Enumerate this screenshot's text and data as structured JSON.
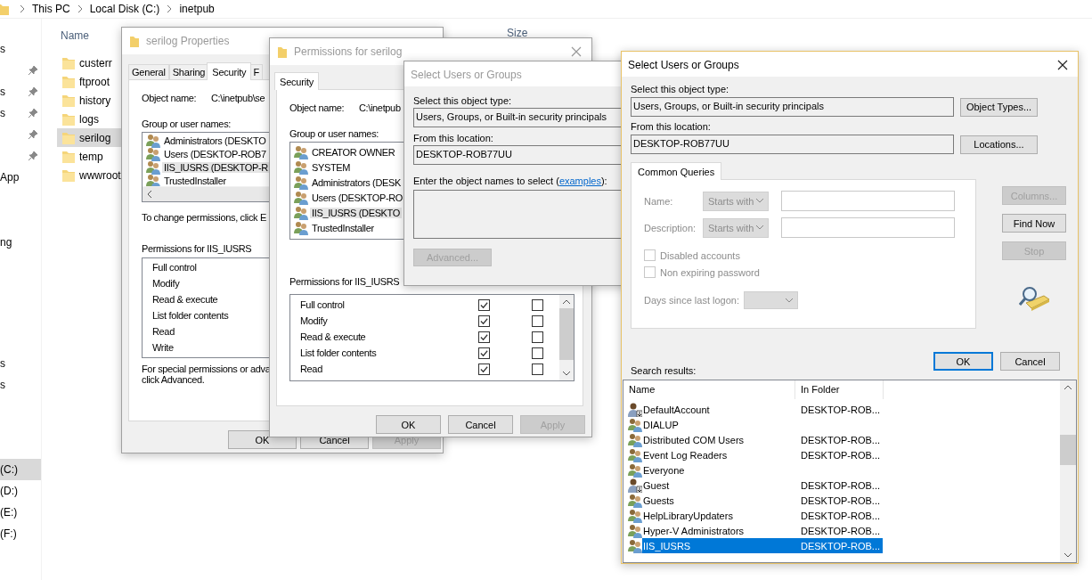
{
  "explorer": {
    "breadcrumb": [
      "This PC",
      "Local Disk (C:)",
      "inetpub"
    ],
    "nav_sections": [
      [
        {
          "label": "s",
          "pinned": false,
          "selected": false
        },
        {
          "pinned": true,
          "selected": false
        },
        {
          "label": "s",
          "pinned": true,
          "selected": false
        },
        {
          "label": "s",
          "pinned": true,
          "selected": false
        },
        {
          "pinned": true,
          "selected": false
        },
        {
          "pinned": true,
          "selected": false
        },
        {
          "label": "App",
          "pinned": false,
          "selected": false
        }
      ],
      [
        {
          "label": "ng",
          "pinned": false,
          "selected": false
        }
      ],
      [
        {
          "label": "s",
          "pinned": false,
          "selected": false
        },
        {
          "label": "s",
          "pinned": false,
          "selected": false
        }
      ],
      [
        {
          "label": "(C:)",
          "pinned": false,
          "selected": true
        },
        {
          "label": "(D:)",
          "pinned": false,
          "selected": false
        },
        {
          "label": "(E:)",
          "pinned": false,
          "selected": false
        },
        {
          "label": "(F:)",
          "pinned": false,
          "selected": false
        }
      ]
    ],
    "columns": [
      "Name",
      "Size"
    ],
    "folders": [
      {
        "name": "custerr",
        "selected": false
      },
      {
        "name": "ftproot",
        "selected": false
      },
      {
        "name": "history",
        "selected": false
      },
      {
        "name": "logs",
        "selected": false
      },
      {
        "name": "serilog",
        "selected": true
      },
      {
        "name": "temp",
        "selected": false
      },
      {
        "name": "wwwroot",
        "selected": false
      }
    ]
  },
  "properties_window": {
    "title": "serilog Properties",
    "active": false,
    "tabs": [
      {
        "label": "General",
        "selected": false
      },
      {
        "label": "Sharing",
        "selected": false
      },
      {
        "label": "Security",
        "selected": true
      },
      {
        "label": "F",
        "selected": false
      }
    ],
    "object_name_label": "Object name:",
    "object_name": "C:\\inetpub\\se",
    "group_label": "Group or user names:",
    "groups": [
      {
        "name": "Administrators (DESKTO",
        "selected": false
      },
      {
        "name": "Users (DESKTOP-ROB7",
        "selected": false
      },
      {
        "name": "IIS_IUSRS (DESKTOP-R",
        "selected": true
      },
      {
        "name": "TrustedInstaller",
        "selected": false
      }
    ],
    "change_hint": "To change permissions, click E",
    "permissions_label": "Permissions for IIS_IUSRS",
    "permissions": [
      "Full control",
      "Modify",
      "Read & execute",
      "List folder contents",
      "Read",
      "Write"
    ],
    "special_hint": "For special permissions or adva",
    "special_hint_2": "click Advanced.",
    "buttons": [
      {
        "label": "OK",
        "disabled": false
      },
      {
        "label": "Cancel",
        "disabled": false
      },
      {
        "label": "Apply",
        "disabled": true
      }
    ]
  },
  "permissions_window": {
    "title": "Permissions for serilog",
    "active": false,
    "tabs": [
      {
        "label": "Security",
        "selected": true
      }
    ],
    "object_name_label": "Object name:",
    "object_name": "C:\\inetpub",
    "group_label": "Group or user names:",
    "groups": [
      {
        "name": "CREATOR OWNER",
        "selected": false
      },
      {
        "name": "SYSTEM",
        "selected": false
      },
      {
        "name": "Administrators (DESK",
        "selected": false
      },
      {
        "name": "Users (DESKTOP-RO",
        "selected": false
      },
      {
        "name": "IIS_IUSRS (DESKTO",
        "selected": true
      },
      {
        "name": "TrustedInstaller",
        "selected": false
      }
    ],
    "permissions_label": "Permissions for IIS_IUSRS",
    "permissions": [
      {
        "name": "Full control",
        "allow": true,
        "deny": false
      },
      {
        "name": "Modify",
        "allow": true,
        "deny": false
      },
      {
        "name": "Read & execute",
        "allow": true,
        "deny": false
      },
      {
        "name": "List folder contents",
        "allow": true,
        "deny": false
      },
      {
        "name": "Read",
        "allow": true,
        "deny": false
      }
    ],
    "buttons": [
      {
        "label": "OK",
        "disabled": false
      },
      {
        "label": "Cancel",
        "disabled": false
      },
      {
        "label": "Apply",
        "disabled": true
      }
    ]
  },
  "select_small": {
    "title": "Select Users or Groups",
    "active": false,
    "type_label": "Select this object type:",
    "object_type": "Users, Groups, or Built-in security principals",
    "location_label": "From this location:",
    "location": "DESKTOP-ROB77UU",
    "names_label": "Enter the object names to select (",
    "names_link": "examples",
    "names_label_end": "):",
    "advanced_button": {
      "label": "Advanced...",
      "disabled": true
    }
  },
  "select_dialog": {
    "title": "Select Users or Groups",
    "active": true,
    "type_label": "Select this object type:",
    "object_type": "Users, Groups, or Built-in security principals",
    "object_types_button": "Object Types...",
    "location_label": "From this location:",
    "location": "DESKTOP-ROB77UU",
    "locations_button": "Locations...",
    "queries": {
      "tab": "Common Queries",
      "disabled": true,
      "name_label": "Name:",
      "name_match": "Starts with",
      "description_label": "Description:",
      "description_match": "Starts with",
      "checkboxes": [
        {
          "label": "Disabled accounts",
          "checked": false
        },
        {
          "label": "Non expiring password",
          "checked": false
        }
      ],
      "days_label": "Days since last logon:"
    },
    "side_buttons": [
      {
        "label": "Columns...",
        "disabled": true
      },
      {
        "label": "Find Now",
        "disabled": false
      },
      {
        "label": "Stop",
        "disabled": true
      }
    ],
    "buttons": [
      {
        "label": "OK",
        "default": true
      },
      {
        "label": "Cancel",
        "default": false
      }
    ],
    "results_label": "Search results:",
    "results_columns": [
      "Name",
      "In Folder"
    ],
    "results": [
      {
        "kind": "user",
        "name": "DefaultAccount",
        "folder": "DESKTOP-ROB...",
        "selected": false
      },
      {
        "kind": "group",
        "name": "DIALUP",
        "selected": false
      },
      {
        "kind": "group",
        "name": "Distributed COM Users",
        "folder": "DESKTOP-ROB...",
        "selected": false
      },
      {
        "kind": "group",
        "name": "Event Log Readers",
        "folder": "DESKTOP-ROB...",
        "selected": false
      },
      {
        "kind": "group",
        "name": "Everyone",
        "selected": false
      },
      {
        "kind": "user",
        "name": "Guest",
        "folder": "DESKTOP-ROB...",
        "selected": false
      },
      {
        "kind": "group",
        "name": "Guests",
        "folder": "DESKTOP-ROB...",
        "selected": false
      },
      {
        "kind": "group",
        "name": "HelpLibraryUpdaters",
        "folder": "DESKTOP-ROB...",
        "selected": false
      },
      {
        "kind": "group",
        "name": "Hyper-V Administrators",
        "folder": "DESKTOP-ROB...",
        "selected": false
      },
      {
        "kind": "group",
        "name": "IIS_IUSRS",
        "folder": "DESKTOP-ROB...",
        "selected": true
      }
    ]
  }
}
